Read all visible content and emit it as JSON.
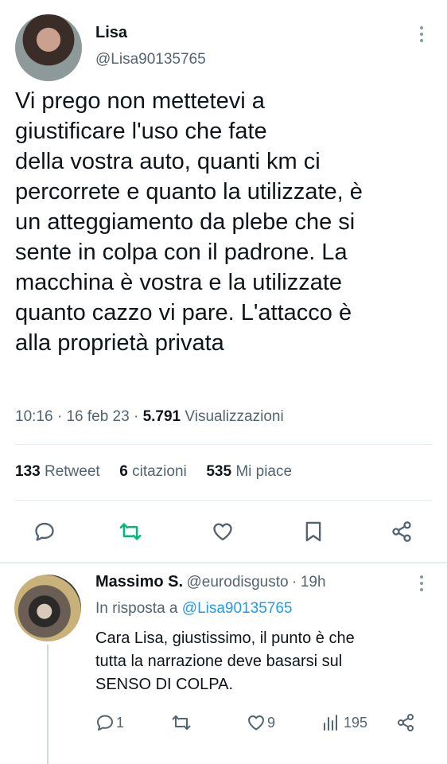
{
  "tweet": {
    "author_name": "Lisa",
    "author_handle": "@Lisa90135765",
    "text_lines": [
      "Vi prego non mettetevi a",
      "giustificare l'uso che fate",
      "della vostra auto, quanti km ci",
      "percorrete e quanto la utilizzate, è",
      "un atteggiamento da plebe che si",
      "sente in colpa con il padrone. La",
      "macchina è vostra e la utilizzate",
      "quanto cazzo vi pare. L'attacco è",
      "alla proprietà privata"
    ],
    "time": "10:16",
    "sep1": "·",
    "date": "16 feb 23",
    "sep2": "·",
    "views_count": "5.791",
    "views_label": "Visualizzazioni",
    "retweets_count": "133",
    "retweets_label": "Retweet",
    "quotes_count": "6",
    "quotes_label": "citazioni",
    "likes_count": "535",
    "likes_label": "Mi piace"
  },
  "reply": {
    "author_name": "Massimo S.",
    "author_handle": "@eurodisgusto",
    "sep": "·",
    "age": "19h",
    "in_reply_prefix": "In risposta a",
    "in_reply_handle": "@Lisa90135765",
    "text_lines": [
      "Cara Lisa, giustissimo, il punto è che",
      "tutta la narrazione deve basarsi sul",
      "SENSO DI COLPA."
    ],
    "reply_count": "1",
    "like_count": "9",
    "views_count": "195"
  },
  "colors": {
    "text": "#0f1419",
    "secondary": "#536471",
    "link": "#1d9bf0",
    "retweet_green": "#00ba7c",
    "divider": "#e6ecf0"
  },
  "icons": [
    "more-icon",
    "reply-icon",
    "retweet-icon",
    "like-icon",
    "bookmark-icon",
    "share-icon",
    "views-icon"
  ]
}
